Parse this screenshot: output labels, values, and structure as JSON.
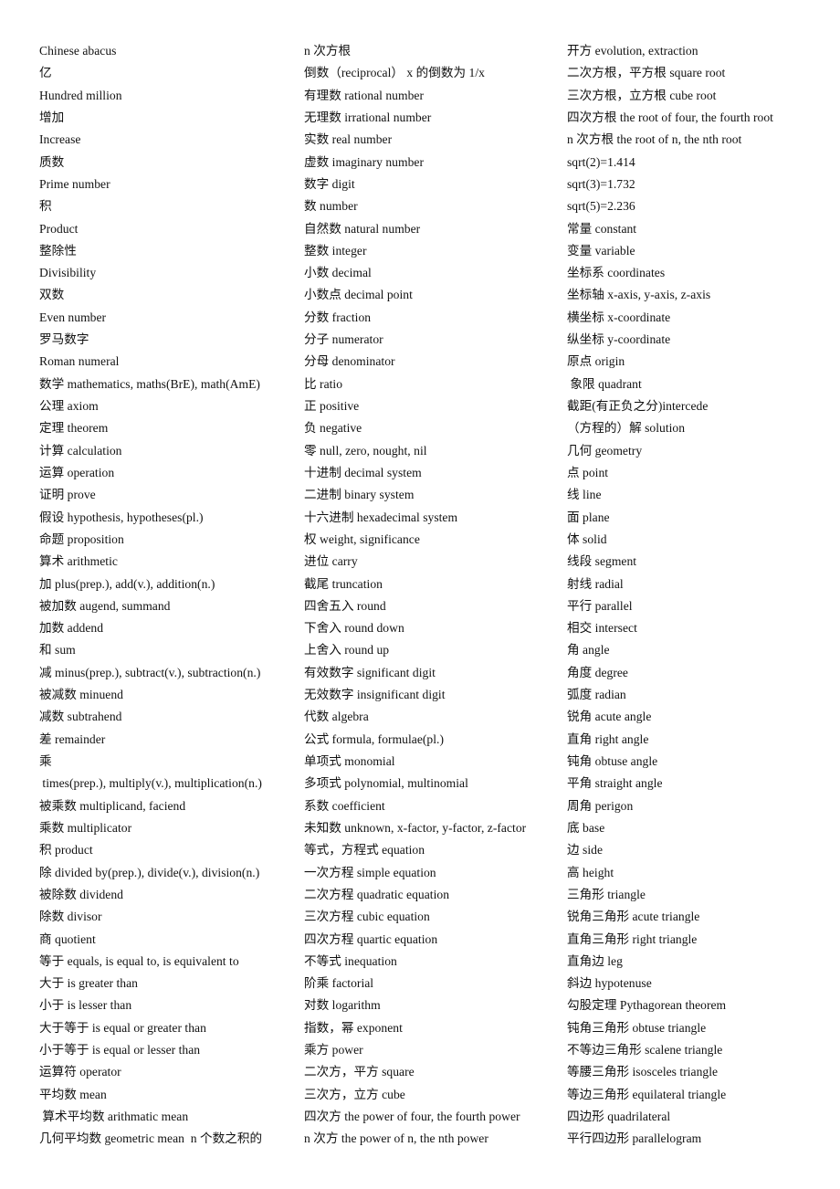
{
  "document": {
    "type": "vocabulary-glossary",
    "subject": "Mathematics Chinese-English glossary",
    "layout": "three-column list"
  },
  "columns": [
    {
      "id": "column-1",
      "entries": [
        "Chinese abacus",
        "亿",
        "Hundred million",
        "增加",
        "Increase",
        "质数",
        "Prime number",
        "积",
        "Product",
        "整除性",
        "Divisibility",
        "双数",
        "Even number",
        "罗马数字",
        "Roman numeral",
        "数学 mathematics, maths(BrE), math(AmE)",
        "公理 axiom",
        "定理 theorem",
        "计算 calculation",
        "运算 operation",
        "证明 prove",
        "假设 hypothesis, hypotheses(pl.)",
        "命题 proposition",
        "算术 arithmetic",
        "加 plus(prep.), add(v.), addition(n.)",
        "被加数 augend, summand",
        "加数 addend",
        "和 sum",
        "减 minus(prep.), subtract(v.), subtraction(n.)",
        "被减数 minuend",
        "减数 subtrahend",
        "差 remainder",
        "乘",
        " times(prep.), multiply(v.), multiplication(n.)",
        "被乘数 multiplicand, faciend",
        "乘数 multiplicator",
        "积 product",
        "除 divided by(prep.), divide(v.), division(n.)",
        "被除数 dividend",
        "除数 divisor",
        "商 quotient",
        "等于 equals, is equal to, is equivalent to",
        "大于 is greater than",
        "小于 is lesser than",
        "大于等于 is equal or greater than",
        "小于等于 is equal or lesser than",
        "运算符 operator",
        "平均数 mean",
        " 算术平均数 arithmatic mean",
        "几何平均数 geometric mean  n 个数之积的"
      ]
    },
    {
      "id": "column-2",
      "entries": [
        "n 次方根",
        "倒数（reciprocal） x 的倒数为 1/x",
        "有理数 rational number",
        "无理数 irrational number",
        "实数 real number",
        "虚数 imaginary number",
        "数字 digit",
        "数 number",
        "自然数 natural number",
        "整数 integer",
        "小数 decimal",
        "小数点 decimal point",
        "分数 fraction",
        "分子 numerator",
        "分母 denominator",
        "比 ratio",
        "正 positive",
        "负 negative",
        "零 null, zero, nought, nil",
        "十进制 decimal system",
        "二进制 binary system",
        "十六进制 hexadecimal system",
        "权 weight, significance",
        "进位 carry",
        "截尾 truncation",
        "四舍五入 round",
        "下舍入 round down",
        "上舍入 round up",
        "有效数字 significant digit",
        "无效数字 insignificant digit",
        "代数 algebra",
        "公式 formula, formulae(pl.)",
        "单项式 monomial",
        "多项式 polynomial, multinomial",
        "系数 coefficient",
        "未知数 unknown, x-factor, y-factor, z-factor",
        "等式，方程式 equation",
        "一次方程 simple equation",
        "二次方程 quadratic equation",
        "三次方程 cubic equation",
        "四次方程 quartic equation",
        "不等式 inequation",
        "阶乘 factorial",
        "对数 logarithm",
        "指数，幂 exponent",
        "乘方 power",
        "二次方，平方 square",
        "三次方，立方 cube",
        "四次方 the power of four, the fourth power",
        "n 次方 the power of n, the nth power"
      ]
    },
    {
      "id": "column-3",
      "entries": [
        "开方 evolution, extraction",
        "二次方根，平方根 square root",
        "三次方根，立方根 cube root",
        "四次方根 the root of four, the fourth root",
        "n 次方根 the root of n, the nth root",
        "sqrt(2)=1.414",
        "sqrt(3)=1.732",
        "sqrt(5)=2.236",
        "常量 constant",
        "变量 variable",
        "坐标系 coordinates",
        "坐标轴 x-axis, y-axis, z-axis",
        "横坐标 x-coordinate",
        "纵坐标 y-coordinate",
        "原点 origin",
        " 象限 quadrant",
        "截距(有正负之分)intercede",
        "（方程的）解 solution",
        "几何 geometry",
        "点 point",
        "线 line",
        "面 plane",
        "体 solid",
        "线段 segment",
        "射线 radial",
        "平行 parallel",
        "相交 intersect",
        "角 angle",
        "角度 degree",
        "弧度 radian",
        "锐角 acute angle",
        "直角 right angle",
        "钝角 obtuse angle",
        "平角 straight angle",
        "周角 perigon",
        "底 base",
        "边 side",
        "高 height",
        "三角形 triangle",
        "锐角三角形 acute triangle",
        "直角三角形 right triangle",
        "直角边 leg",
        "斜边 hypotenuse",
        "勾股定理 Pythagorean theorem",
        "钝角三角形 obtuse triangle",
        "不等边三角形 scalene triangle",
        "等腰三角形 isosceles triangle",
        "等边三角形 equilateral triangle",
        "四边形 quadrilateral",
        "平行四边形 parallelogram"
      ]
    }
  ]
}
